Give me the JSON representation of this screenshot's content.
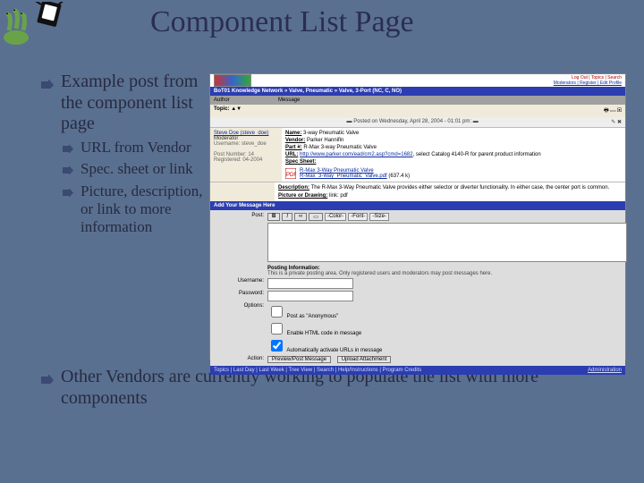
{
  "title": "Component List Page",
  "left": {
    "main": "Example post from the component list page",
    "subs": [
      "URL from Vendor",
      "Spec. sheet or link",
      "Picture, description, or link to more information"
    ]
  },
  "foot": "Other Vendors are currently working to populate the list with more components",
  "shot": {
    "hdr_links_1": "Log Out | Topics | Search",
    "hdr_links_2": "Moderators | Register | Edit Profile",
    "crumbs": "BoT01 Knowledge Network » Valve, Pneumatic » Valve, 3-Port (NC, C, NO)",
    "band_author": "Author",
    "band_message": "Message",
    "topic": "Topic:",
    "topic_text": "Valve, 3-Port (NC, C, NO)",
    "posted_line": "Posted on Wednesday, April 28, 2004 - 01:01 pm:",
    "user_name": "Steve Doe (steve_doe)",
    "user_role": "Moderator",
    "user_join": "Registered: 04-2004",
    "name_lbl": "Name:",
    "name_val": "3-way Pneumatic Valve",
    "vendor_lbl": "Vendor:",
    "vendor_val": "Parker Hannifin",
    "partno_lbl": "Part #:",
    "partno_val": "R-Max 3-way Pneumatic Valve",
    "url_lbl": "URL:",
    "url_val": "http://www.parker.com/ead/cm2.asp?cmd=1682",
    "url_tail": ", select Catalog 4140-R for parent product information",
    "spec_lbl": "Spec Sheet:",
    "pdf_name": "R-Max 3-Way Pneumatic Valve",
    "pdf_file": "R-Max_3-Way_Pneumatic_Valve.pdf",
    "pdf_size": "(637.4 k)",
    "desc_lbl": "Description:",
    "desc_val": "The R-Max 3-Way Pneumatic Valve provides either selector or diverter functionality. In either case, the center port is common.",
    "pic_lbl": "Picture or Drawing:",
    "pic_val": "link: pdf",
    "add_bar": "Add Your Message Here",
    "post_lbl": "Post:",
    "sel_color": "-Color-",
    "sel_font": "-Font-",
    "sel_size": "-Size-",
    "posting_info": "Posting Information:",
    "posting_note": "This is a private posting area. Only registered users and moderators may post messages here.",
    "username_lbl": "Username:",
    "password_lbl": "Password:",
    "options_lbl": "Options:",
    "opt1": "Post as \"Anonymous\"",
    "opt2": "Enable HTML code in message",
    "opt3": "Automatically activate URLs in message",
    "action_lbl": "Action:",
    "btn_preview": "Preview/Post Message",
    "btn_attach": "Upload Attachment",
    "footer_left": "Topics | Last Day | Last Week | Tree View | Search | Help/Instructions | Program Credits",
    "footer_right": "Administration"
  }
}
